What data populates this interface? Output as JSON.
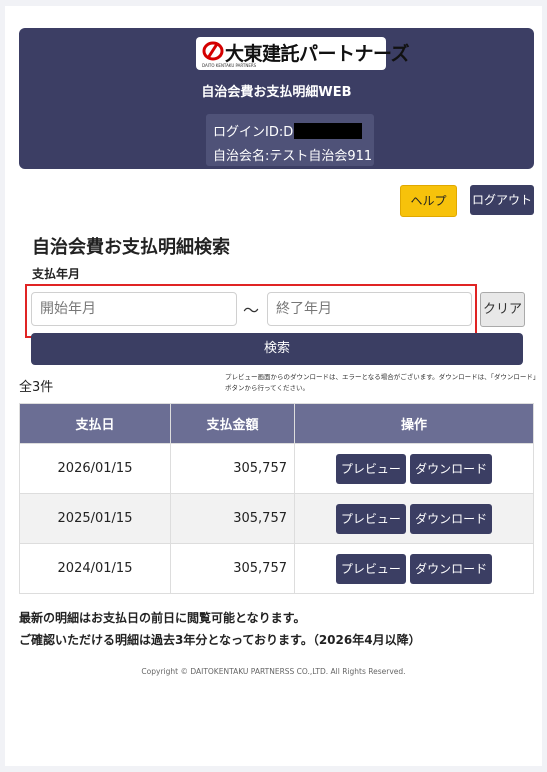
{
  "header": {
    "logo_text": "大東建託パートナーズ",
    "logo_subtext": "DAITO KENTAKU PARTNERS",
    "app_title": "自治会費お支払明細WEB",
    "login_id_label": "ログインID:D",
    "association_name": "自治会名:テスト自治会911"
  },
  "toolbar": {
    "help_label": "ヘルプ",
    "logout_label": "ログアウト"
  },
  "search": {
    "title": "自治会費お支払明細検索",
    "period_label": "支払年月",
    "start_placeholder": "開始年月",
    "separator": "～",
    "end_placeholder": "終了年月",
    "clear_label": "クリア",
    "search_label": "検索"
  },
  "results": {
    "count": "全3件",
    "note": "プレビュー画面からのダウンロードは、エラーとなる場合がございます。ダウンロードは、「ダウンロード」ボタンから行ってください。",
    "columns": [
      "支払日",
      "支払金額",
      "操作"
    ],
    "rows": [
      {
        "date": "2026/01/15",
        "amount": "305,757"
      },
      {
        "date": "2025/01/15",
        "amount": "305,757"
      },
      {
        "date": "2024/01/15",
        "amount": "305,757"
      }
    ],
    "preview_label": "プレビュー",
    "download_label": "ダウンロード"
  },
  "notes": {
    "line1": "最新の明細はお支払日の前日に閲覧可能となります。",
    "line2": "ご確認いただける明細は過去3年分となっております。（2026年4月以降）"
  },
  "footer": {
    "copyright": "Copyright © DAITOKENTAKU PARTNERSS CO.,LTD. All Rights Reserved."
  },
  "colors": {
    "primary": "#3b3e63",
    "help": "#f7c20b",
    "highlight": "#e02424",
    "table_header": "#6b6e94"
  }
}
